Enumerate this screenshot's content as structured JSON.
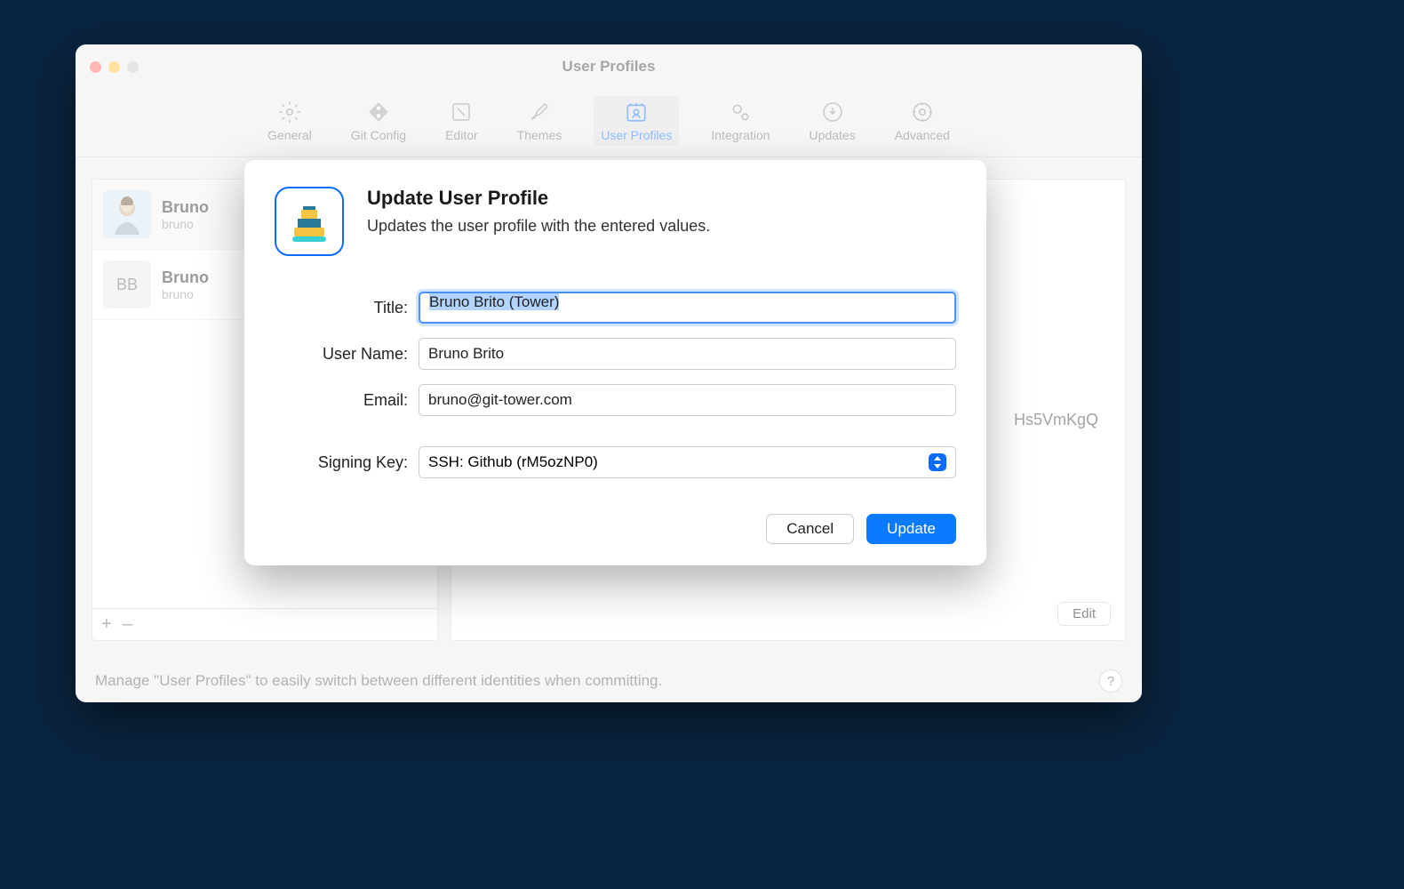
{
  "window": {
    "title": "User Profiles"
  },
  "toolbar": {
    "items": [
      {
        "label": "General"
      },
      {
        "label": "Git Config"
      },
      {
        "label": "Editor"
      },
      {
        "label": "Themes"
      },
      {
        "label": "User Profiles"
      },
      {
        "label": "Integration"
      },
      {
        "label": "Updates"
      },
      {
        "label": "Advanced"
      }
    ]
  },
  "profiles": [
    {
      "name": "Bruno",
      "email": "bruno",
      "initials": ""
    },
    {
      "name": "Bruno",
      "email": "bruno",
      "initials": "BB"
    }
  ],
  "detail": {
    "key_fragment": "Hs5VmKgQ",
    "edit_label": "Edit"
  },
  "footer": {
    "text": "Manage \"User Profiles\" to easily switch between different identities when committing.",
    "help": "?"
  },
  "list_actions": {
    "add": "+",
    "remove": "–"
  },
  "modal": {
    "title": "Update User Profile",
    "subtitle": "Updates the user profile with the entered values.",
    "labels": {
      "title": "Title:",
      "username": "User Name:",
      "email": "Email:",
      "signing_key": "Signing Key:"
    },
    "values": {
      "title": "Bruno Brito (Tower)",
      "username": "Bruno Brito",
      "email": "bruno@git-tower.com",
      "signing_key": "SSH: Github (rM5ozNP0)"
    },
    "actions": {
      "cancel": "Cancel",
      "update": "Update"
    }
  }
}
